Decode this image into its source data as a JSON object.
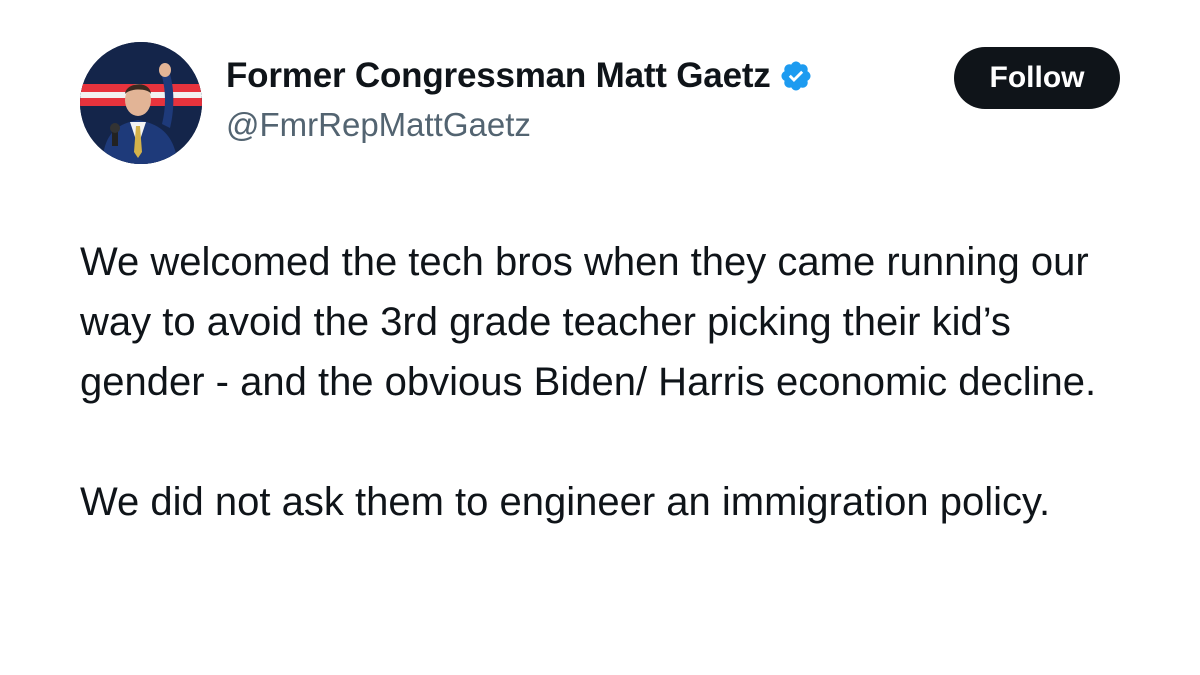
{
  "author": {
    "display_name": "Former Congressman Matt Gaetz",
    "handle": "@FmrRepMattGaetz",
    "verified_icon": "verified-badge-icon",
    "avatar_icon": "profile-photo"
  },
  "actions": {
    "follow_label": "Follow"
  },
  "tweet": {
    "paragraphs": [
      "We welcomed the tech bros when they came running our way to avoid the 3rd grade teacher picking their kid’s gender - and the obvious Biden/ Harris economic decline.",
      "We did not ask them to engineer an immigration policy."
    ]
  },
  "colors": {
    "text_primary": "#0f1419",
    "text_secondary": "#536471",
    "verified_blue": "#1d9bf0",
    "button_bg": "#0f1419",
    "button_text": "#ffffff"
  }
}
